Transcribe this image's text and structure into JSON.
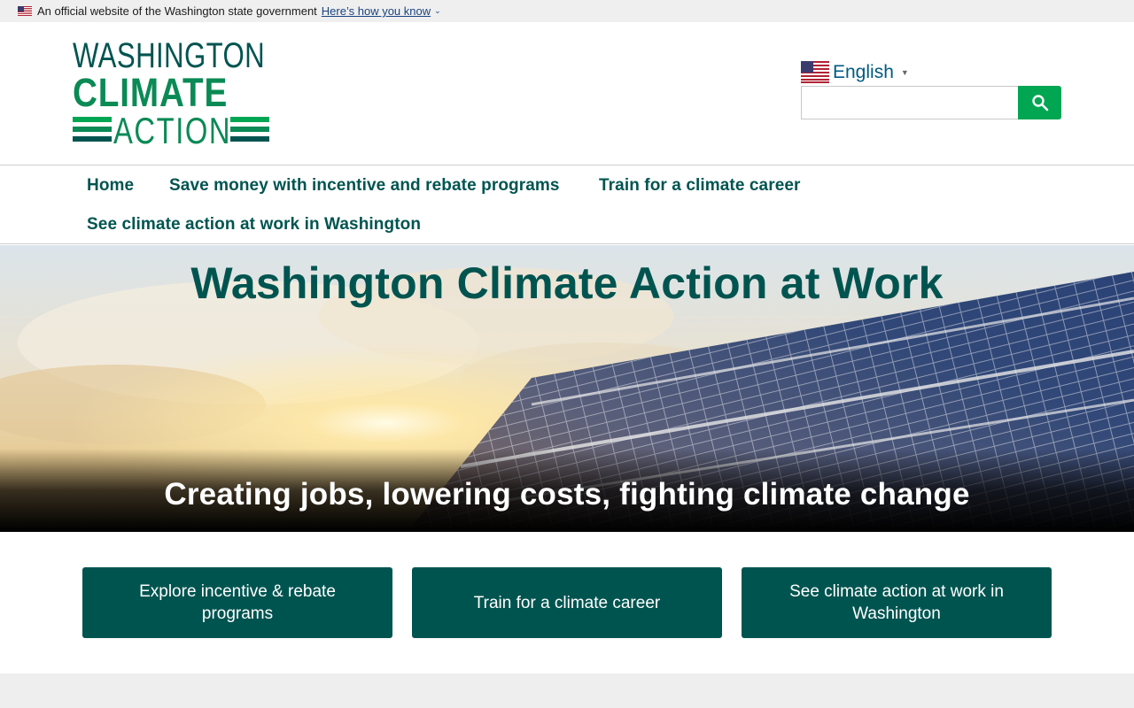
{
  "gov_banner": {
    "text": "An official website of the Washington state government",
    "link": "Here’s how you know",
    "icon": "us-flag-icon"
  },
  "logo": {
    "line1": "WASHINGTON",
    "line2": "CLIMATE",
    "line3": "ACTION"
  },
  "language": {
    "label": "English",
    "caret": "▼",
    "icon": "us-flag-icon"
  },
  "search": {
    "value": "",
    "placeholder": "",
    "icon": "search-icon"
  },
  "nav": {
    "items": [
      "Home",
      "Save money with incentive and rebate programs",
      "Train for a climate career",
      "See climate action at work in Washington"
    ]
  },
  "hero": {
    "title": "Washington Climate Action at Work",
    "subtitle": "Creating jobs, lowering costs, fighting climate change"
  },
  "cta": [
    "Explore incentive & rebate programs",
    "Train for a climate career",
    "See climate action at work in Washington"
  ],
  "colors": {
    "primary": "#005450",
    "accent": "#00a651",
    "link": "#1a4480"
  }
}
